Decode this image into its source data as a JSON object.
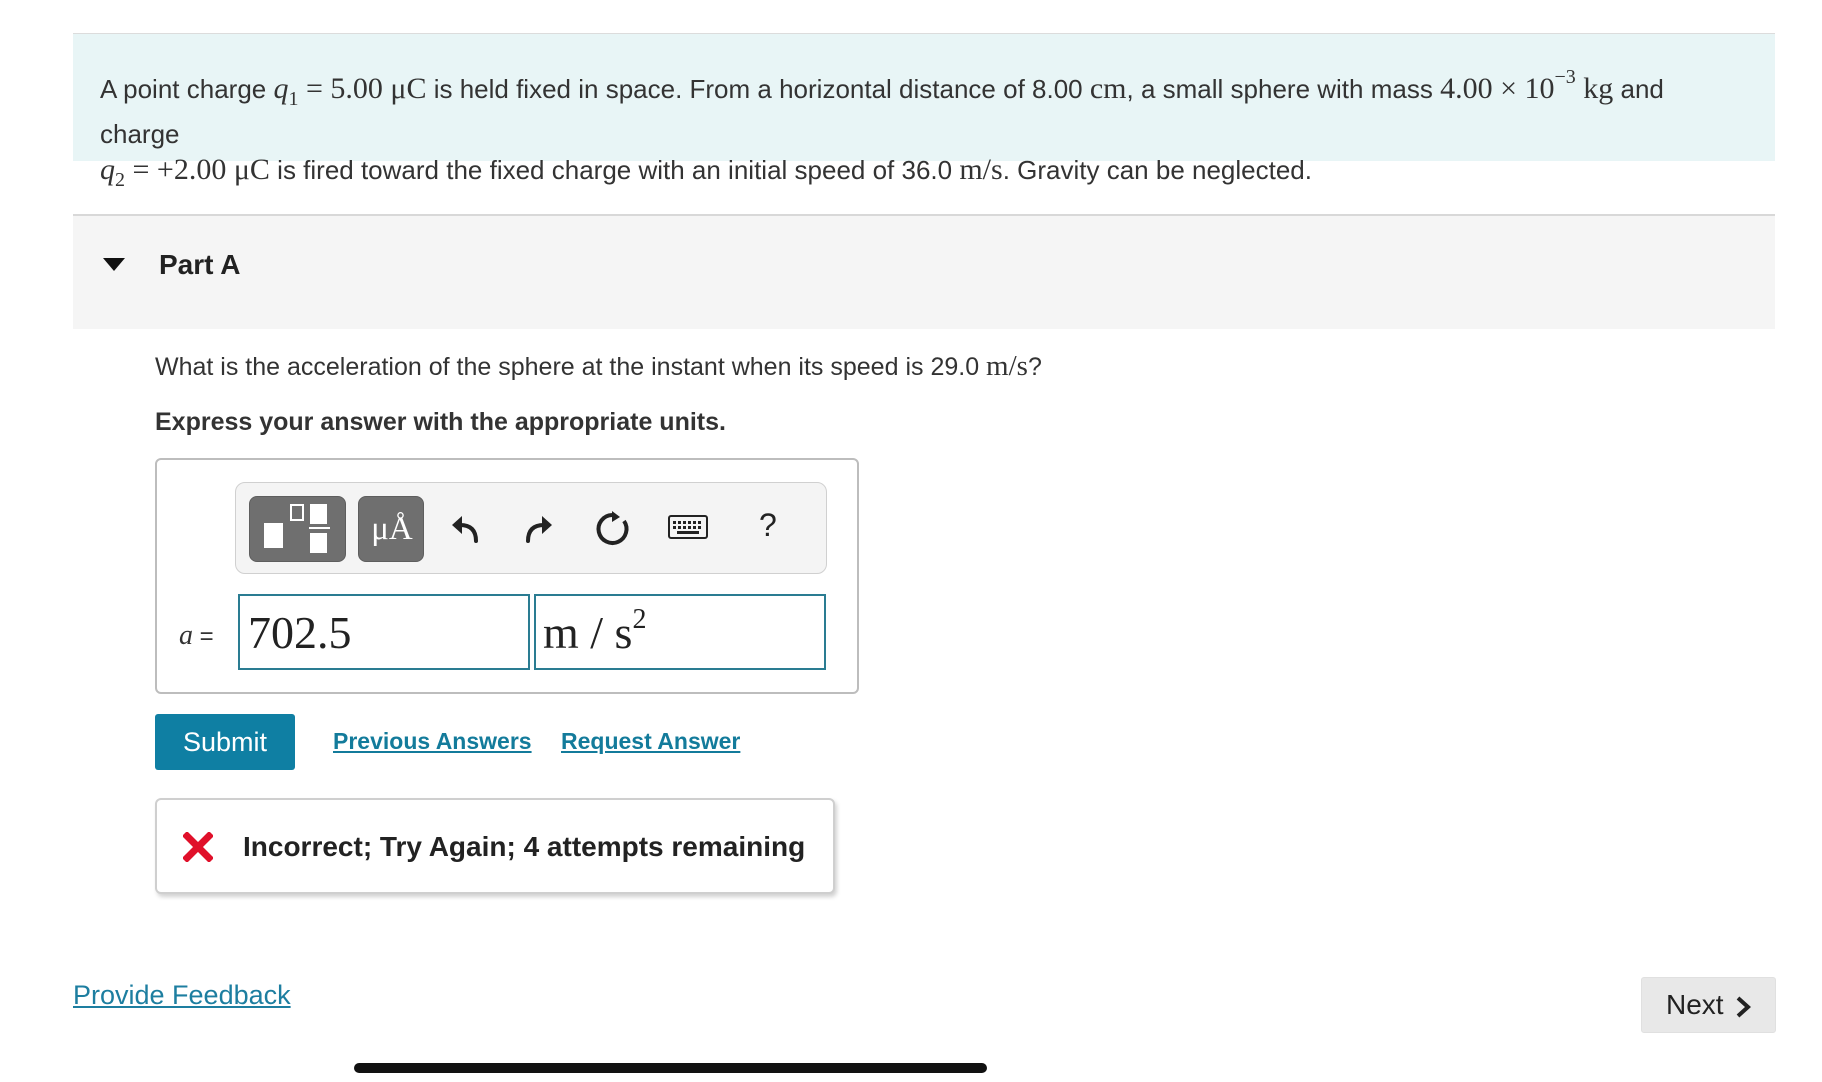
{
  "problem": {
    "t1": "A point charge ",
    "q1_sym": "q",
    "q1_sub": "1",
    "q1_eq": " = 5.00 μC",
    "t2": " is held fixed in space. From a horizontal distance of 8.00 ",
    "cm": "cm",
    "t3": ", a small sphere with mass ",
    "mass": "4.00 × 10",
    "mass_exp": "−3",
    "kg": " kg",
    "t4": " and charge ",
    "q2_sym": "q",
    "q2_sub": "2",
    "q2_eq": " = +2.00 μC",
    "t5": " is fired toward the fixed charge with an initial speed of 36.0 ",
    "speed_units": "m/s",
    "t6": ". Gravity can be neglected."
  },
  "part": {
    "title": "Part A"
  },
  "question": {
    "text": "What is the acceleration of the sphere at the instant when its speed is 29.0 ",
    "units": "m/s",
    "end": "?"
  },
  "instruction": "Express your answer with the appropriate units.",
  "toolbar": {
    "units_label": "μÅ",
    "help_label": "?"
  },
  "answer": {
    "variable": "a",
    "equals": " =",
    "value": "702.5",
    "units": "m / s",
    "units_exp": "2"
  },
  "actions": {
    "submit": "Submit",
    "previous_answers": "Previous Answers",
    "request_answer": "Request Answer"
  },
  "feedback": {
    "message": "Incorrect; Try Again; 4 attempts remaining",
    "status_color": "#e0102a"
  },
  "footer": {
    "provide_feedback": "Provide Feedback",
    "next": "Next"
  },
  "colors": {
    "accent": "#0f7fa3",
    "link": "#137b9b",
    "problem_bg": "#e8f5f6"
  }
}
